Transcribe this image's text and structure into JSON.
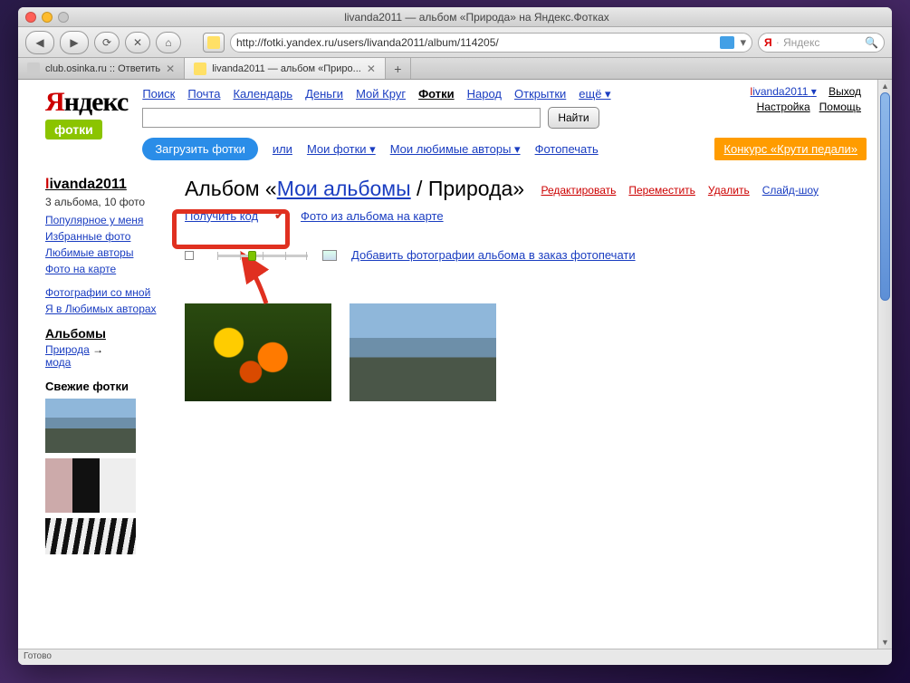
{
  "window": {
    "title": "livanda2011 — альбом «Природа» на Яндекс.Фотках",
    "url": "http://fotki.yandex.ru/users/livanda2011/album/114205/",
    "status": "Готово",
    "search_placeholder": "Яндекс"
  },
  "tabs": [
    {
      "label": "club.osinka.ru :: Ответить",
      "active": false
    },
    {
      "label": "livanda2011 — альбом «Приро...",
      "active": true
    }
  ],
  "topnav": {
    "items": [
      "Поиск",
      "Почта",
      "Календарь",
      "Деньги",
      "Мой Круг",
      "Фотки",
      "Народ",
      "Открытки",
      "ещё ▾"
    ],
    "active_index": 5
  },
  "user": {
    "name_first": "l",
    "name_rest": "ivanda2011",
    "dropdown": "▾",
    "exit": "Выход",
    "settings": "Настройка",
    "help": "Помощь"
  },
  "logo": {
    "red": "Я",
    "black": "ндекс",
    "sub": "фотки"
  },
  "search": {
    "find": "Найти"
  },
  "subnav": {
    "upload": "Загрузить фотки",
    "or": "или",
    "my_photos": "Мои фотки ▾",
    "fav_authors": "Мои любимые авторы ▾",
    "photoprint": "Фотопечать",
    "contest": "Конкурс «Крути педали»"
  },
  "sidebar": {
    "user_first": "l",
    "user_rest": "ivanda2011",
    "stat": "3 альбома, 10 фото",
    "links": [
      "Популярное у меня",
      "Избранные фото",
      "Любимые авторы",
      "Фото на карте"
    ],
    "links2": [
      "Фотографии со мной",
      "Я в Любимых авторах"
    ],
    "albums_hdr": "Альбомы",
    "album_current": "Природа",
    "album_arrow": "→",
    "album_other": "мода",
    "fresh_hdr": "Свежие фотки"
  },
  "heading": {
    "prefix": "Альбом «",
    "link": "Мои альбомы",
    "suffix": " / Природа»",
    "actions": {
      "edit": "Редактировать",
      "move": "Переместить",
      "delete": "Удалить",
      "slideshow": "Слайд-шоу"
    }
  },
  "linkrow": {
    "get_code": "Получить код",
    "on_map": "Фото из альбома на карте"
  },
  "slider": {
    "order_print": "Добавить фотографии альбома в заказ фотопечати"
  }
}
